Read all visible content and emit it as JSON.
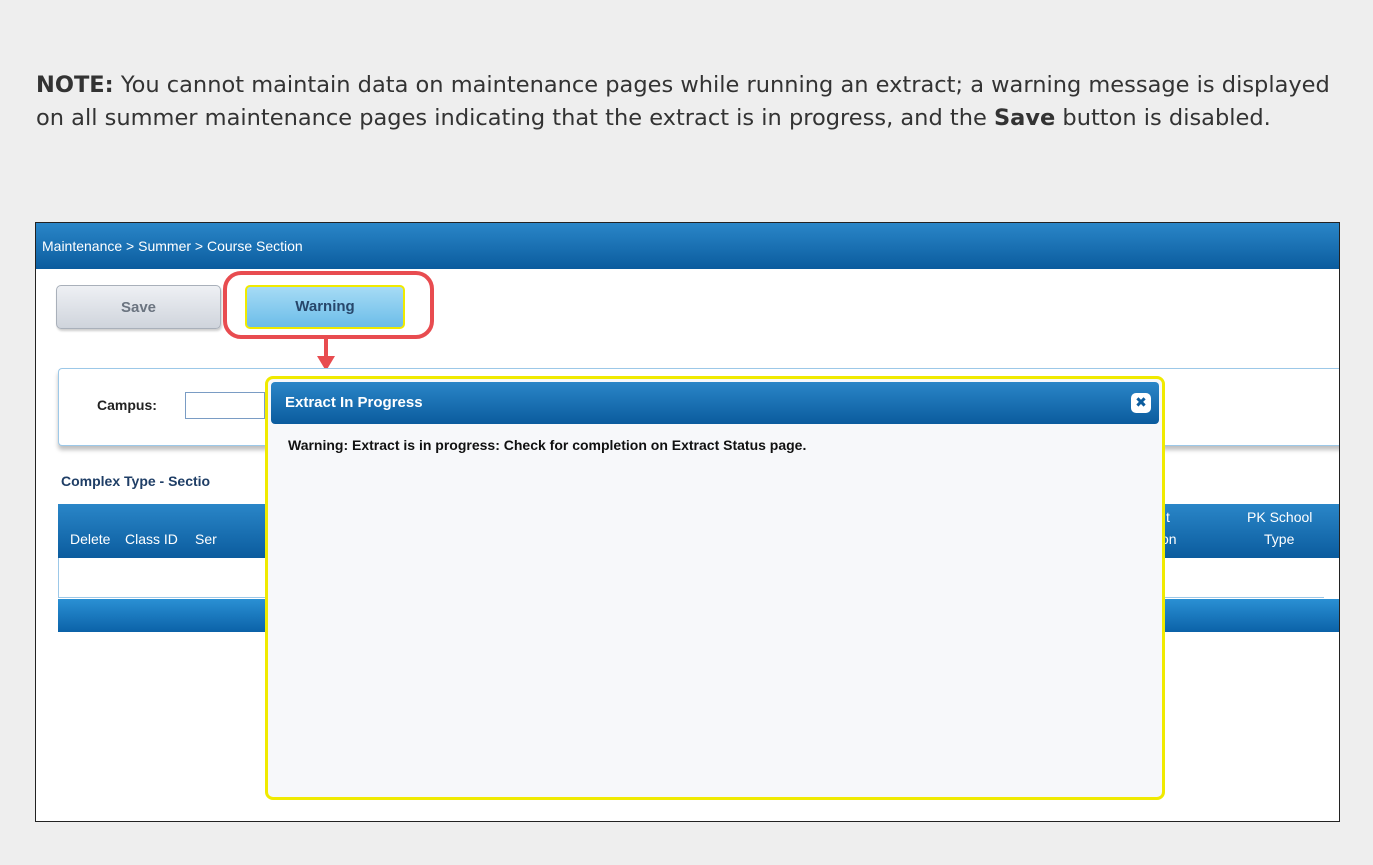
{
  "note": {
    "label": "NOTE:",
    "text_1": " You cannot maintain data on maintenance pages while running an extract; a warning message is displayed on all summer maintenance pages indicating that the extract is in progress, and the ",
    "bold_word": "Save",
    "text_2": " button is disabled."
  },
  "breadcrumb": "Maintenance > Summer > Course Section",
  "toolbar": {
    "save_label": "Save",
    "warning_label": "Warning"
  },
  "filter": {
    "campus_label": "Campus:",
    "campus_value": ""
  },
  "section_title": "Complex Type - Sectio",
  "grid": {
    "columns": [
      "Delete",
      "Class ID",
      "Ser",
      "t",
      "on",
      "PK School",
      "Type"
    ]
  },
  "modal": {
    "title": "Extract In Progress",
    "close_glyph": "✖",
    "message": "Warning: Extract is in progress: Check for completion on Extract Status page."
  },
  "colors": {
    "header_blue": "#0b5c9e",
    "highlight_red": "#e84c50",
    "highlight_yellow": "#f0ea00"
  }
}
